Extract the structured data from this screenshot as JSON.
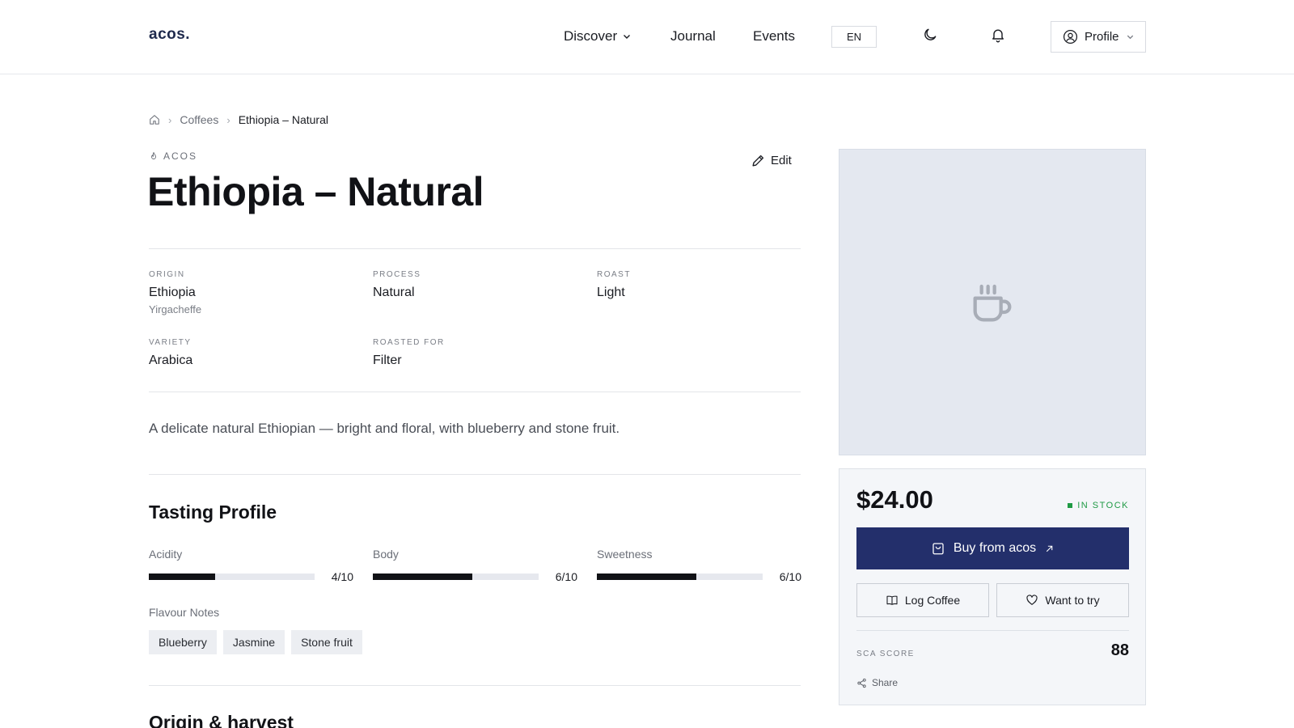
{
  "header": {
    "logo": "acos.",
    "nav": {
      "discover": "Discover",
      "journal": "Journal",
      "events": "Events"
    },
    "language": "EN",
    "profile_label": "Profile"
  },
  "breadcrumb": {
    "coffees": "Coffees",
    "current": "Ethiopia – Natural"
  },
  "coffee": {
    "roaster": "ACOS",
    "edit_label": "Edit",
    "title": "Ethiopia – Natural",
    "attributes": {
      "origin": {
        "label": "ORIGIN",
        "value": "Ethiopia",
        "sub": "Yirgacheffe"
      },
      "process": {
        "label": "PROCESS",
        "value": "Natural"
      },
      "roast": {
        "label": "ROAST",
        "value": "Light"
      },
      "variety": {
        "label": "VARIETY",
        "value": "Arabica"
      },
      "roasted_for": {
        "label": "ROASTED FOR",
        "value": "Filter"
      }
    },
    "description": "A delicate natural Ethiopian — bright and floral, with blueberry and stone fruit."
  },
  "tasting": {
    "title": "Tasting Profile",
    "acidity": {
      "label": "Acidity",
      "score": "4/10",
      "value": 4
    },
    "body": {
      "label": "Body",
      "score": "6/10",
      "value": 6
    },
    "sweetness": {
      "label": "Sweetness",
      "score": "6/10",
      "value": 6
    },
    "flavour_label": "Flavour Notes",
    "notes": [
      "Blueberry",
      "Jasmine",
      "Stone fruit"
    ]
  },
  "origin_section": {
    "title": "Origin & harvest"
  },
  "purchase": {
    "price": "$24.00",
    "stock": "IN STOCK",
    "buy_label": "Buy from acos",
    "log_label": "Log Coffee",
    "want_label": "Want to try",
    "sca_label": "SCA SCORE",
    "sca_value": "88",
    "share_label": "Share"
  },
  "colors": {
    "accent": "#232f6b",
    "stock_green": "#1f9a45",
    "meter_fill": "#111216",
    "image_placeholder": "#e4e8f0"
  }
}
